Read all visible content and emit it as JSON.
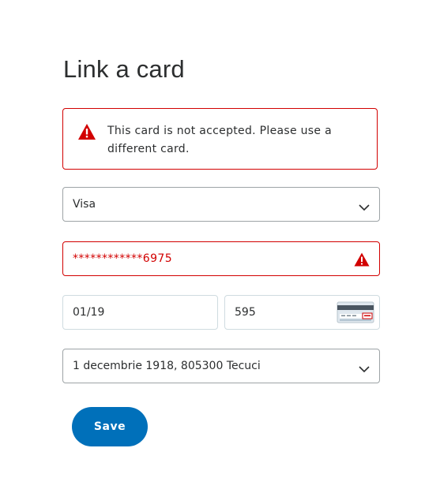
{
  "page": {
    "title": "Link a card"
  },
  "alert": {
    "icon": "warning-triangle-icon",
    "message": "This card is not accepted. Please use a different card.",
    "color": "#d20000"
  },
  "form": {
    "card_type": {
      "value": "Visa",
      "icon": "chevron-down-icon"
    },
    "card_number": {
      "value": "************6975",
      "error_icon": "warning-triangle-icon"
    },
    "expiry": {
      "value": "01/19"
    },
    "cvv": {
      "value": "595",
      "icon": "card-cvv-icon"
    },
    "billing_address": {
      "value": "1 decembrie 1918, 805300 Tecuci",
      "icon": "chevron-down-icon"
    }
  },
  "actions": {
    "save_label": "Save",
    "accent_color": "#0070ba"
  }
}
